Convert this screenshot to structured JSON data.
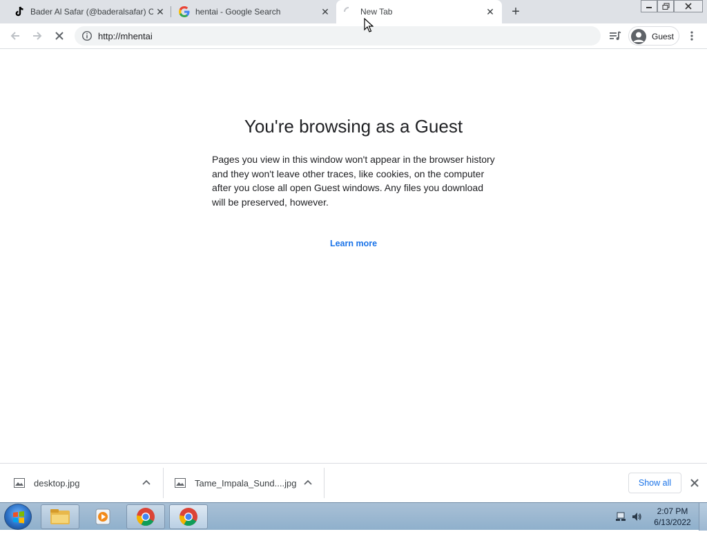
{
  "tabs": [
    {
      "title": "Bader Al Safar (@baderalsafar) C",
      "favicon": "tiktok-icon"
    },
    {
      "title": "hentai - Google Search",
      "favicon": "google-icon"
    },
    {
      "title": "New Tab",
      "favicon": "loading-spinner-icon"
    }
  ],
  "omnibox": {
    "url": "http://mhentai"
  },
  "profile": {
    "label": "Guest"
  },
  "page": {
    "heading": "You're browsing as a Guest",
    "body": "Pages you view in this window won't appear in the browser history and they won't leave other traces, like cookies, on the computer after you close all open Guest windows. Any files you download will be preserved, however.",
    "learn_more": "Learn more"
  },
  "downloads": {
    "items": [
      {
        "name": "desktop.jpg"
      },
      {
        "name": "Tame_Impala_Sund....jpg"
      }
    ],
    "show_all": "Show all"
  },
  "taskbar": {
    "time": "2:07 PM",
    "date": "6/13/2022"
  },
  "colors": {
    "accent": "#1a73e8",
    "tabstrip": "#dee1e6",
    "text": "#202124"
  }
}
